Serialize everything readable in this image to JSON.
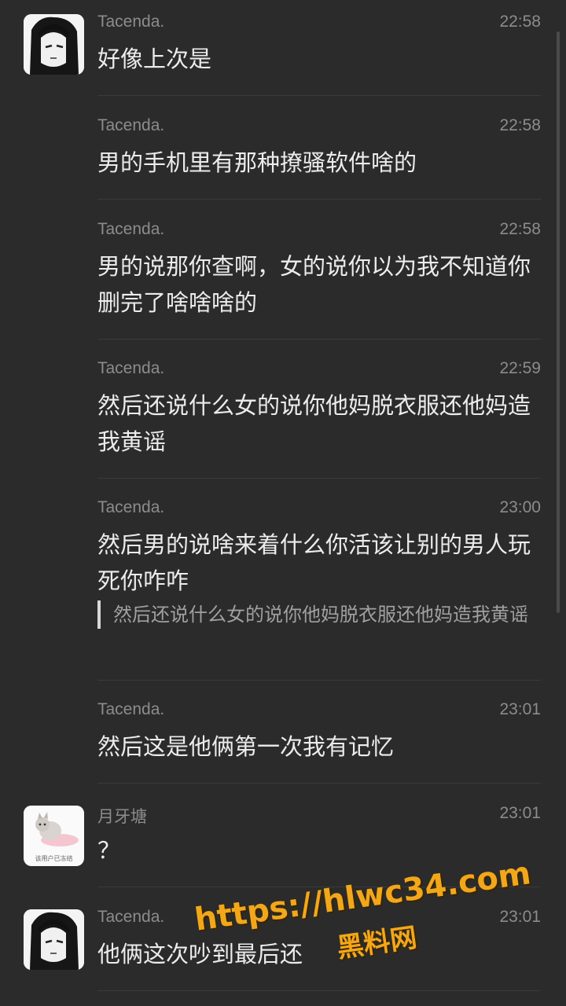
{
  "messages": [
    {
      "sender": "Tacenda.",
      "time": "22:58",
      "text": "好像上次是",
      "avatar": "anime-girl-avatar-icon"
    },
    {
      "sender": "Tacenda.",
      "time": "22:58",
      "text": "男的手机里有那种撩骚软件啥的"
    },
    {
      "sender": "Tacenda.",
      "time": "22:58",
      "text": "男的说那你查啊，女的说你以为我不知道你删完了啥啥啥的"
    },
    {
      "sender": "Tacenda.",
      "time": "22:59",
      "text": "然后还说什么女的说你他妈脱衣服还他妈造我黄谣"
    },
    {
      "sender": "Tacenda.",
      "time": "23:00",
      "text": "然后男的说啥来着什么你活该让别的男人玩死你咋咋",
      "quote": "然后还说什么女的说你他妈脱衣服还他妈造我黄谣"
    },
    {
      "sender": "Tacenda.",
      "time": "23:01",
      "text": "然后这是他俩第一次我有记忆"
    },
    {
      "sender": "月牙塘",
      "time": "23:01",
      "text": "？",
      "avatar": "cat-avatar-icon",
      "avatar_caption": "该用户已冻结"
    },
    {
      "sender": "Tacenda.",
      "time": "23:01",
      "text": "他俩这次吵到最后还",
      "avatar": "anime-girl-avatar-icon"
    }
  ],
  "watermark": {
    "url": "https://hlwc34.com",
    "name": "黑料网"
  }
}
